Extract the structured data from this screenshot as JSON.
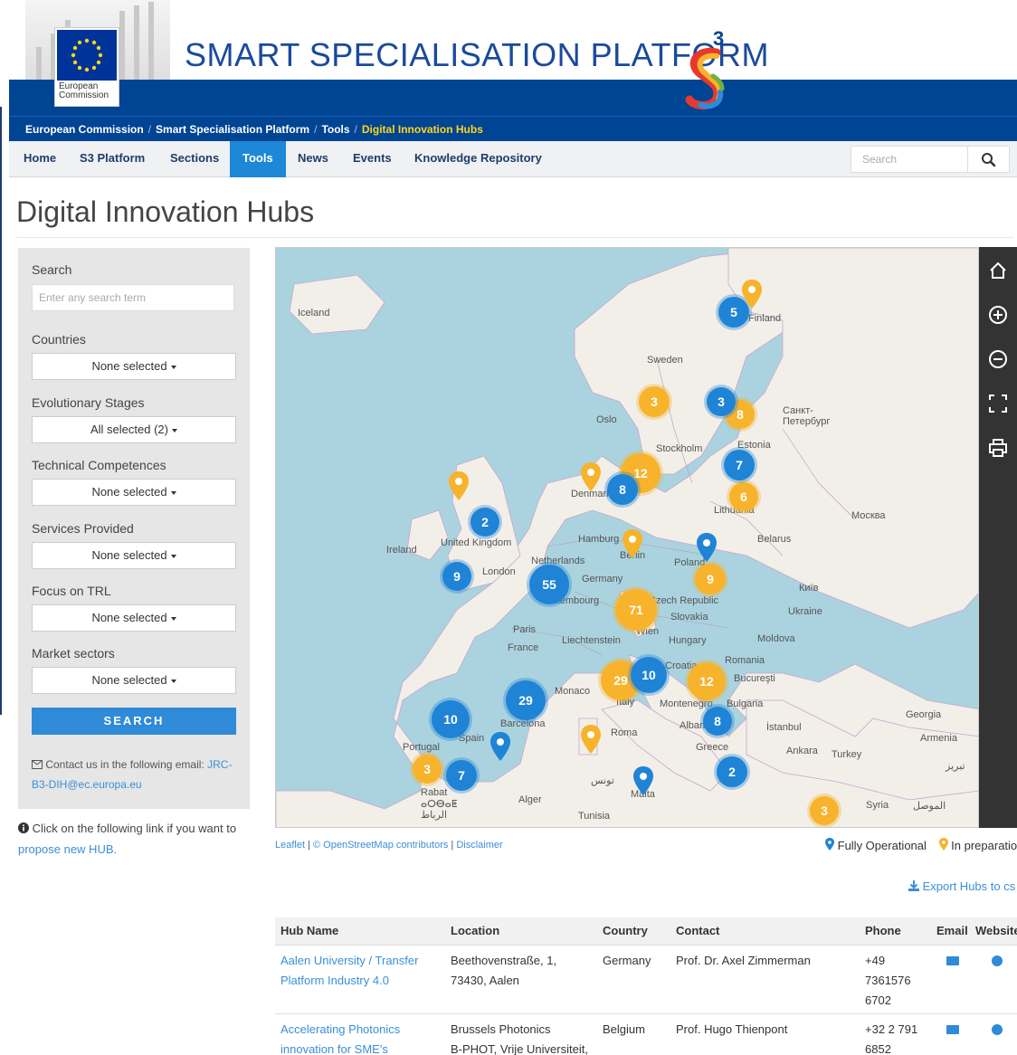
{
  "header": {
    "site_title": "SMART SPECIALISATION PLATFORM",
    "ec_logo_line1": "European",
    "ec_logo_line2": "Commission",
    "brand_color": "#004494"
  },
  "breadcrumb": {
    "items": [
      "European Commission",
      "Smart Specialisation Platform",
      "Tools"
    ],
    "current": "Digital Innovation Hubs",
    "separator": "/"
  },
  "nav": {
    "items": [
      "Home",
      "S3 Platform",
      "Sections",
      "Tools",
      "News",
      "Events",
      "Knowledge Repository"
    ],
    "active": "Tools",
    "search_placeholder": "Search"
  },
  "page_title": "Digital Innovation Hubs",
  "filters": {
    "search_label": "Search",
    "search_placeholder": "Enter any search term",
    "groups": [
      {
        "label": "Countries",
        "value": "None selected"
      },
      {
        "label": "Evolutionary Stages",
        "value": "All selected (2)"
      },
      {
        "label": "Technical Competences",
        "value": "None selected"
      },
      {
        "label": "Services Provided",
        "value": "None selected"
      },
      {
        "label": "Focus on TRL",
        "value": "None selected"
      },
      {
        "label": "Market sectors",
        "value": "None selected"
      }
    ],
    "search_button": "SEARCH",
    "contact_text": "Contact us in the following email:",
    "contact_email": "JRC-B3-DIH@ec.europa.eu"
  },
  "propose": {
    "text": "Click on the following link if you want to",
    "link": "propose new HUB."
  },
  "map": {
    "labels": [
      "Iceland",
      "Finland",
      "Sweden",
      "Oslo",
      "Stockholm",
      "Санкт-Петербург",
      "Estonia",
      "Москва",
      "Lithuania",
      "Belarus",
      "Denmark",
      "Ireland",
      "United Kingdom",
      "London",
      "Hamburg",
      "Berlin",
      "Netherlands",
      "Poland",
      "Germany",
      "Luxembourg",
      "Czech Republic",
      "Київ",
      "Ukraine",
      "Slovakia",
      "Paris",
      "France",
      "Wien",
      "Liechtenstein",
      "Hungary",
      "Moldova",
      "Romania",
      "Croatia",
      "Bucureşti",
      "Monaco",
      "Italy",
      "Montenegro",
      "Bulgaria",
      "Barcelona",
      "Albania",
      "Roma",
      "İstanbul",
      "Georgia",
      "Portugal",
      "Spain",
      "Greece",
      "Ankara",
      "Turkey",
      "Armenia",
      "Rabat",
      "Alger",
      "Tunisia",
      "Malta",
      "Syria",
      "تونس",
      "ⴰⵔⴱⴰⵟ",
      "الرباط",
      "تبريز",
      "الموصل"
    ],
    "blue_clusters": [
      5,
      3,
      7,
      8,
      2,
      9,
      55,
      29,
      10,
      10,
      8,
      7,
      2
    ],
    "yellow_clusters": [
      3,
      8,
      12,
      6,
      9,
      71,
      12,
      29,
      3,
      3
    ],
    "toolbar_icons": [
      "home-icon",
      "zoom-in-icon",
      "zoom-out-icon",
      "fullscreen-icon",
      "print-icon"
    ]
  },
  "map_footer": {
    "leaflet": "Leaflet",
    "osm": "© OpenStreetMap contributors",
    "disclaimer": "Disclaimer",
    "legend_operational": "Fully Operational",
    "legend_preparation": "In preparatio",
    "operational_color": "#1f84d6",
    "preparation_color": "#f7b32b"
  },
  "export_label": "Export Hubs to cs",
  "table": {
    "headers": [
      "Hub Name",
      "Location",
      "Country",
      "Contact",
      "Phone",
      "Email",
      "Website"
    ],
    "rows": [
      {
        "name_l1": "Aalen University / Transfer",
        "name_l2": "Platform Industry 4.0",
        "loc_l1": "Beethovenstraße, 1,",
        "loc_l2": "73430, Aalen",
        "country": "Germany",
        "contact": "Prof. Dr. Axel Zimmerman",
        "phone_l1": "+49",
        "phone_l2": "7361576",
        "phone_l3": "6702"
      },
      {
        "name_l1": "Accelerating Photonics",
        "name_l2": "innovation for SME's",
        "loc_l1": "Brussels Photonics",
        "loc_l2": "B-PHOT, Vrije Universiteit,",
        "country": "Belgium",
        "contact": "Prof. Hugo Thienpont",
        "phone_l1": "+32 2 791",
        "phone_l2": "6852",
        "phone_l3": ""
      }
    ]
  }
}
